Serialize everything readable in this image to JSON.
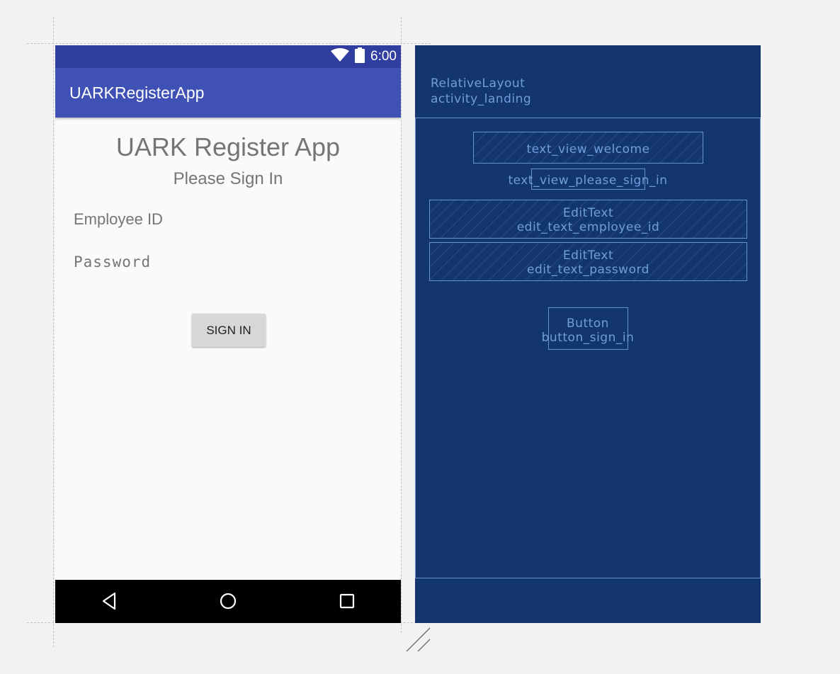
{
  "design": {
    "status_bar": {
      "time": "6:00",
      "icons": [
        "wifi-icon",
        "battery-icon"
      ]
    },
    "app_bar": {
      "title": "UARKRegisterApp"
    },
    "welcome_text": "UARK Register App",
    "please_sign_in_text": "Please Sign In",
    "employee_id_field": {
      "placeholder": "Employee ID",
      "value": ""
    },
    "password_field": {
      "placeholder": "Password",
      "value": ""
    },
    "sign_in_button": {
      "label": "SIGN IN"
    },
    "nav_bar": {
      "icons": [
        "back-icon",
        "home-icon",
        "recents-icon"
      ]
    }
  },
  "blueprint": {
    "layout_type": "RelativeLayout",
    "layout_id": "activity_landing",
    "welcome_id": "text_view_welcome",
    "please_sign_in_id": "text_view_please_sign_in",
    "employee_id_type": "EditText",
    "employee_id_id": "edit_text_employee_id",
    "password_type": "EditText",
    "password_id": "edit_text_password",
    "button_type": "Button",
    "button_id": "button_sign_in"
  },
  "colors": {
    "status_bar": "#303f9f",
    "app_bar": "#3f51b5",
    "blueprint_bg": "#14366e",
    "blueprint_line": "#6a92cc",
    "blueprint_text": "#6f9ed9"
  }
}
